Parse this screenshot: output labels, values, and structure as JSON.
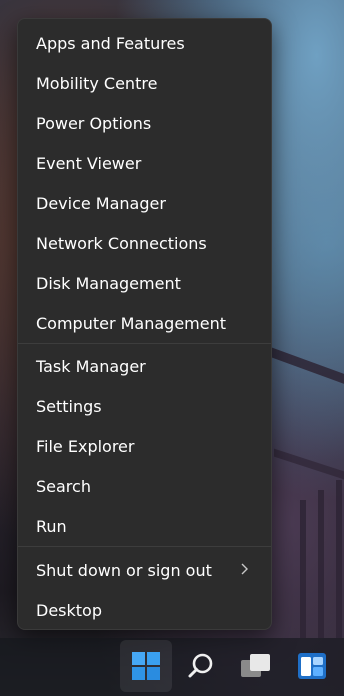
{
  "menu": {
    "group1": [
      {
        "name": "menu-item-apps-and-features",
        "label": "Apps and Features"
      },
      {
        "name": "menu-item-mobility-centre",
        "label": "Mobility Centre"
      },
      {
        "name": "menu-item-power-options",
        "label": "Power Options"
      },
      {
        "name": "menu-item-event-viewer",
        "label": "Event Viewer"
      },
      {
        "name": "menu-item-device-manager",
        "label": "Device Manager"
      },
      {
        "name": "menu-item-network-connections",
        "label": "Network Connections"
      },
      {
        "name": "menu-item-disk-management",
        "label": "Disk Management"
      },
      {
        "name": "menu-item-computer-management",
        "label": "Computer Management"
      }
    ],
    "group2": [
      {
        "name": "menu-item-task-manager",
        "label": "Task Manager"
      },
      {
        "name": "menu-item-settings",
        "label": "Settings"
      },
      {
        "name": "menu-item-file-explorer",
        "label": "File Explorer"
      },
      {
        "name": "menu-item-search",
        "label": "Search"
      },
      {
        "name": "menu-item-run",
        "label": "Run"
      }
    ],
    "group3": [
      {
        "name": "menu-item-shut-down-or-sign-out",
        "label": "Shut down or sign out"
      },
      {
        "name": "menu-item-desktop",
        "label": "Desktop"
      }
    ]
  },
  "taskbar": {
    "icons": [
      "windows-start-icon",
      "search-icon",
      "task-view-icon",
      "widgets-icon"
    ]
  },
  "colors": {
    "menu_bg": "#2c2c2c",
    "text": "#ffffff",
    "start_blue": "#3aa0f0"
  }
}
